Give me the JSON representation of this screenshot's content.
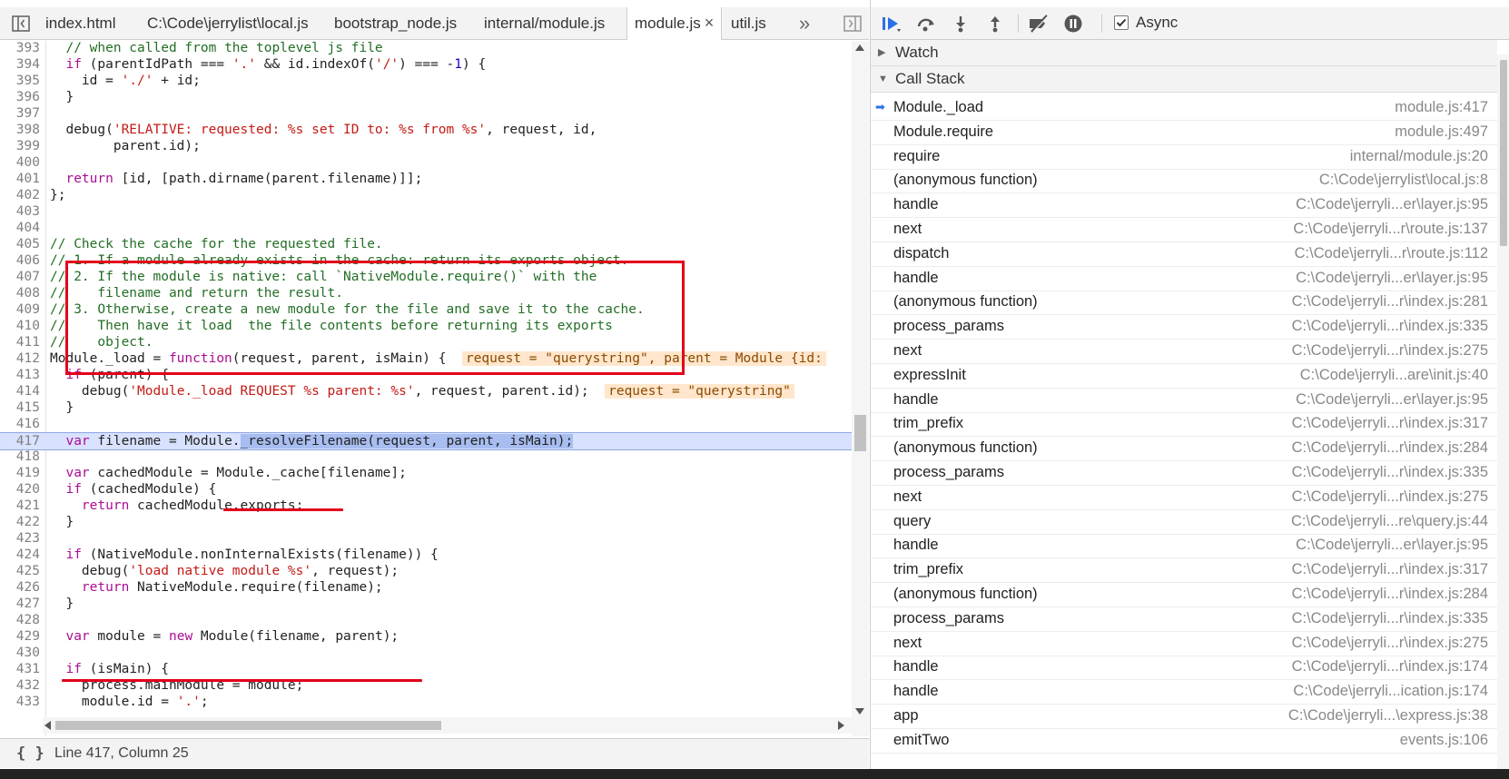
{
  "tabs": [
    {
      "label": "index.html",
      "active": false
    },
    {
      "label": "C:\\Code\\jerrylist\\local.js",
      "active": false
    },
    {
      "label": "bootstrap_node.js",
      "active": false
    },
    {
      "label": "internal/module.js",
      "active": false
    },
    {
      "label": "module.js",
      "active": true,
      "close": "×"
    },
    {
      "label": "util.js",
      "active": false
    }
  ],
  "tabbar": {
    "overflow_icon": "»",
    "toggle_navigator_icon": "sidebar-toggle-icon",
    "toggle_debugger_icon": "sidebar-toggle-icon"
  },
  "code_lines": [
    {
      "n": "393",
      "html": "  <span class=\"cm\">// when called from the toplevel js file</span>"
    },
    {
      "n": "394",
      "html": "  <span class=\"kw\">if</span> (parentIdPath === <span class=\"str\">'.'</span> &amp;&amp; id.indexOf(<span class=\"str\">'/'</span>) === -<span class=\"num\">1</span>) {"
    },
    {
      "n": "395",
      "html": "    id = <span class=\"str\">'./'</span> + id;"
    },
    {
      "n": "396",
      "html": "  }"
    },
    {
      "n": "397",
      "html": ""
    },
    {
      "n": "398",
      "html": "  debug(<span class=\"str\">'RELATIVE: requested: %s set ID to: %s from %s'</span>, request, id,"
    },
    {
      "n": "399",
      "html": "        parent.id);"
    },
    {
      "n": "400",
      "html": ""
    },
    {
      "n": "401",
      "html": "  <span class=\"kw\">return</span> [id, [path.dirname(parent.filename)]];"
    },
    {
      "n": "402",
      "html": "};"
    },
    {
      "n": "403",
      "html": ""
    },
    {
      "n": "404",
      "html": ""
    },
    {
      "n": "405",
      "html": "<span class=\"cm\">// Check the cache for the requested file.</span>"
    },
    {
      "n": "406",
      "html": "<span class=\"cm\">// 1. If a module already exists in the cache: return its exports object.</span>"
    },
    {
      "n": "407",
      "html": "<span class=\"cm\">// 2. If the module is native: call `NativeModule.require()` with the</span>"
    },
    {
      "n": "408",
      "html": "<span class=\"cm\">//    filename and return the result.</span>"
    },
    {
      "n": "409",
      "html": "<span class=\"cm\">// 3. Otherwise, create a new module for the file and save it to the cache.</span>"
    },
    {
      "n": "410",
      "html": "<span class=\"cm\">//    Then have it load  the file contents before returning its exports</span>"
    },
    {
      "n": "411",
      "html": "<span class=\"cm\">//    object.</span>"
    },
    {
      "n": "412",
      "html": "Module._load = <span class=\"kw\">function</span>(request, parent, isMain) {  <span class=\"inline-val\">request = \"querystring\", parent = Module {id:</span>"
    },
    {
      "n": "413",
      "html": "  <span class=\"kw\">if</span> (parent) {"
    },
    {
      "n": "414",
      "html": "    debug(<span class=\"str\">'Module._load REQUEST %s parent: %s'</span>, request, parent.id);  <span class=\"inline-val\">request = \"querystring\"</span>"
    },
    {
      "n": "415",
      "html": "  }"
    },
    {
      "n": "416",
      "html": ""
    },
    {
      "n": "417",
      "html": "  <span class=\"kw\">var</span> filename = Module.<span class=\"sel\">_resolveFilename(request, parent, isMain);</span>",
      "exec": true
    },
    {
      "n": "418",
      "html": ""
    },
    {
      "n": "419",
      "html": "  <span class=\"kw\">var</span> cachedModule = Module._cache[filename];"
    },
    {
      "n": "420",
      "html": "  <span class=\"kw\">if</span> (cachedModule) {"
    },
    {
      "n": "421",
      "html": "    <span class=\"kw\">return</span> cachedModule.exports;"
    },
    {
      "n": "422",
      "html": "  }"
    },
    {
      "n": "423",
      "html": ""
    },
    {
      "n": "424",
      "html": "  <span class=\"kw\">if</span> (NativeModule.nonInternalExists(filename)) {"
    },
    {
      "n": "425",
      "html": "    debug(<span class=\"str\">'load native module %s'</span>, request);"
    },
    {
      "n": "426",
      "html": "    <span class=\"kw\">return</span> NativeModule.require(filename);"
    },
    {
      "n": "427",
      "html": "  }"
    },
    {
      "n": "428",
      "html": ""
    },
    {
      "n": "429",
      "html": "  <span class=\"kw\">var</span> module = <span class=\"kw\">new</span> Module(filename, parent);"
    },
    {
      "n": "430",
      "html": ""
    },
    {
      "n": "431",
      "html": "  <span class=\"kw\">if</span> (isMain) {"
    },
    {
      "n": "432",
      "html": "    process.mainModule = module;"
    },
    {
      "n": "433",
      "html": "    module.id = <span class=\"str\">'.'</span>;"
    }
  ],
  "status_bar": {
    "format_icon": "{ }",
    "position": "Line 417, Column 25"
  },
  "debugger": {
    "async_label": "Async",
    "async_checked": true,
    "watch_label": "Watch",
    "call_stack_label": "Call Stack",
    "buttons": [
      "resume-icon",
      "step-over-icon",
      "step-into-icon",
      "step-out-icon",
      "deactivate-breakpoints-icon",
      "pause-on-exceptions-icon"
    ]
  },
  "call_stack": [
    {
      "name": "Module._load",
      "location": "module.js:417",
      "current": true
    },
    {
      "name": "Module.require",
      "location": "module.js:497"
    },
    {
      "name": "require",
      "location": "internal/module.js:20"
    },
    {
      "name": "(anonymous function)",
      "location": "C:\\Code\\jerrylist\\local.js:8"
    },
    {
      "name": "handle",
      "location": "C:\\Code\\jerryli...er\\layer.js:95"
    },
    {
      "name": "next",
      "location": "C:\\Code\\jerryli...r\\route.js:137"
    },
    {
      "name": "dispatch",
      "location": "C:\\Code\\jerryli...r\\route.js:112"
    },
    {
      "name": "handle",
      "location": "C:\\Code\\jerryli...er\\layer.js:95"
    },
    {
      "name": "(anonymous function)",
      "location": "C:\\Code\\jerryli...r\\index.js:281"
    },
    {
      "name": "process_params",
      "location": "C:\\Code\\jerryli...r\\index.js:335"
    },
    {
      "name": "next",
      "location": "C:\\Code\\jerryli...r\\index.js:275"
    },
    {
      "name": "expressInit",
      "location": "C:\\Code\\jerryli...are\\init.js:40"
    },
    {
      "name": "handle",
      "location": "C:\\Code\\jerryli...er\\layer.js:95"
    },
    {
      "name": "trim_prefix",
      "location": "C:\\Code\\jerryli...r\\index.js:317"
    },
    {
      "name": "(anonymous function)",
      "location": "C:\\Code\\jerryli...r\\index.js:284"
    },
    {
      "name": "process_params",
      "location": "C:\\Code\\jerryli...r\\index.js:335"
    },
    {
      "name": "next",
      "location": "C:\\Code\\jerryli...r\\index.js:275"
    },
    {
      "name": "query",
      "location": "C:\\Code\\jerryli...re\\query.js:44"
    },
    {
      "name": "handle",
      "location": "C:\\Code\\jerryli...er\\layer.js:95"
    },
    {
      "name": "trim_prefix",
      "location": "C:\\Code\\jerryli...r\\index.js:317"
    },
    {
      "name": "(anonymous function)",
      "location": "C:\\Code\\jerryli...r\\index.js:284"
    },
    {
      "name": "process_params",
      "location": "C:\\Code\\jerryli...r\\index.js:335"
    },
    {
      "name": "next",
      "location": "C:\\Code\\jerryli...r\\index.js:275"
    },
    {
      "name": "handle",
      "location": "C:\\Code\\jerryli...r\\index.js:174"
    },
    {
      "name": "handle",
      "location": "C:\\Code\\jerryli...ication.js:174"
    },
    {
      "name": "app",
      "location": "C:\\Code\\jerryli...\\express.js:38"
    },
    {
      "name": "emitTwo",
      "location": "events.js:106"
    }
  ],
  "colors": {
    "annotation": "#e3001b",
    "exec_line": "#d8e2ff",
    "active_frame_arrow": "#2b70e6"
  }
}
